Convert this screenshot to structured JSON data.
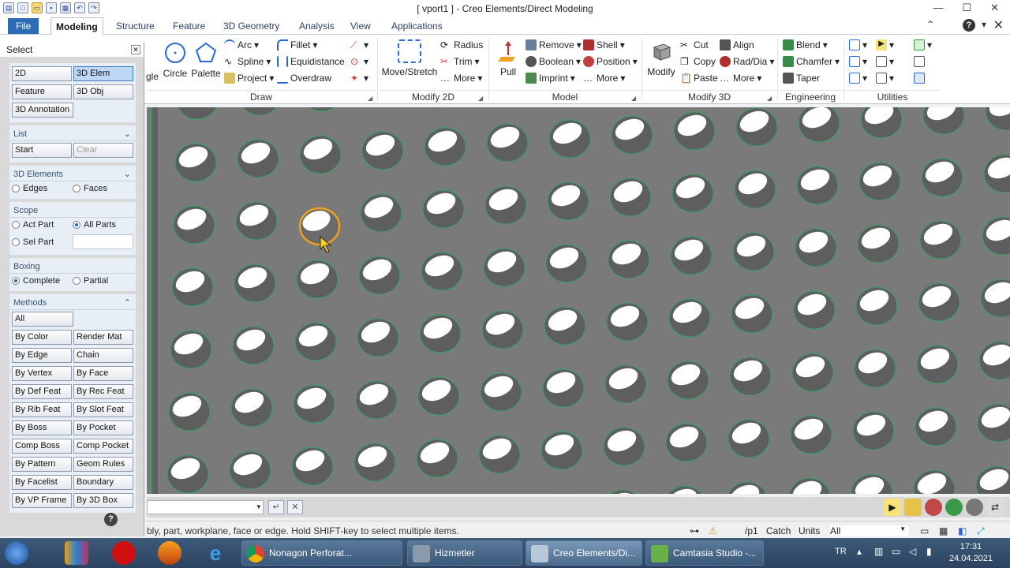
{
  "window": {
    "title": "[ vport1 ] - Creo Elements/Direct Modeling",
    "qat_icons": [
      "new-icon",
      "open-icon",
      "save-icon",
      "print-icon",
      "undo-icon",
      "redo-icon"
    ]
  },
  "menu": {
    "file": "File",
    "tabs": [
      "Modeling",
      "Structure",
      "Feature",
      "3D Geometry",
      "Analysis",
      "View",
      "Applications"
    ],
    "active": "Modeling"
  },
  "ribbon": {
    "draw": {
      "gle": "gle",
      "circle": "Circle",
      "palette": "Palette",
      "arc": "Arc",
      "spline": "Spline",
      "project": "Project",
      "fillet": "Fillet",
      "equidistance": "Equidistance",
      "overdraw": "Overdraw",
      "label": "Draw"
    },
    "modify2d": {
      "move": "Move/Stretch",
      "radius": "Radius",
      "trim": "Trim",
      "more": "More",
      "label": "Modify 2D"
    },
    "model": {
      "pull": "Pull",
      "remove": "Remove",
      "boolean": "Boolean",
      "imprint": "Imprint",
      "shell": "Shell",
      "position": "Position",
      "more": "More",
      "label": "Model"
    },
    "modify3d": {
      "modify": "Modify",
      "cut": "Cut",
      "copy": "Copy",
      "paste": "Paste",
      "align": "Align",
      "raddia": "Rad/Dia",
      "more": "More",
      "label": "Modify 3D"
    },
    "engineering": {
      "blend": "Blend",
      "chamfer": "Chamfer",
      "taper": "Taper",
      "label": "Engineering"
    },
    "utilities": {
      "label": "Utilities"
    }
  },
  "panel": {
    "title": "Select",
    "top_buttons": [
      "2D",
      "3D Elem",
      "Feature",
      "3D Obj",
      "3D Annotation"
    ],
    "list": {
      "title": "List",
      "start": "Start",
      "clear": "Clear"
    },
    "elements": {
      "title": "3D Elements",
      "edges": "Edges",
      "faces": "Faces"
    },
    "scope": {
      "title": "Scope",
      "act_part": "Act Part",
      "all_parts": "All Parts",
      "sel_part": "Sel Part"
    },
    "boxing": {
      "title": "Boxing",
      "complete": "Complete",
      "partial": "Partial"
    },
    "methods": {
      "title": "Methods",
      "all": "All",
      "buttons": [
        "By Color",
        "Render Mat",
        "By Edge",
        "Chain",
        "By Vertex",
        "By Face",
        "By Def Feat",
        "By Rec Feat",
        "By Rib Feat",
        "By Slot Feat",
        "By Boss",
        "By Pocket",
        "Comp Boss",
        "Comp Pocket",
        "By Pattern",
        "Geom Rules",
        "By Facelist",
        "Boundary",
        "By VP Frame",
        "By 3D Box"
      ]
    }
  },
  "status": {
    "message": "bly, part, workplane, face or edge. Hold SHIFT-key to select multiple items.",
    "viewport": "/p1",
    "catch": "Catch",
    "units": "Units",
    "filter": "All"
  },
  "taskbar": {
    "items": [
      "Nonagon Perforat...",
      "Hizmetler",
      "Creo Elements/Di...",
      "Camtasia Studio -..."
    ],
    "lang": "TR",
    "time": "17:31",
    "date": "24.04.2021"
  },
  "colors": {
    "viewport_bg": "#7a7a7a",
    "hole_edge": "#2fa866",
    "highlight": "#f0a020",
    "accent": "#1f5fb0"
  }
}
